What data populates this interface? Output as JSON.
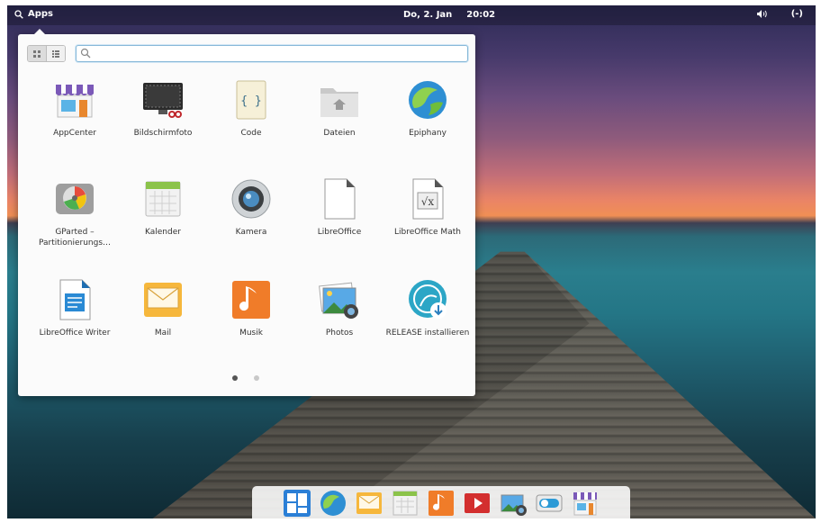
{
  "topbar": {
    "apps_label": "Apps",
    "date": "Do, 2. Jan",
    "time": "20:02",
    "session_symbol": "(-)"
  },
  "launcher": {
    "search_placeholder": "",
    "apps": [
      {
        "name": "AppCenter",
        "icon": "appcenter-icon"
      },
      {
        "name": "Bildschirmfoto",
        "icon": "screenshot-icon"
      },
      {
        "name": "Code",
        "icon": "code-icon"
      },
      {
        "name": "Dateien",
        "icon": "files-icon"
      },
      {
        "name": "Epiphany",
        "icon": "epiphany-icon"
      },
      {
        "name": "GParted – Partitionierungs…",
        "icon": "gparted-icon"
      },
      {
        "name": "Kalender",
        "icon": "calendar-icon"
      },
      {
        "name": "Kamera",
        "icon": "camera-icon"
      },
      {
        "name": "LibreOffice",
        "icon": "libreoffice-icon"
      },
      {
        "name": "LibreOffice Math",
        "icon": "libreoffice-math-icon"
      },
      {
        "name": "LibreOffice Writer",
        "icon": "libreoffice-writer-icon"
      },
      {
        "name": "Mail",
        "icon": "mail-icon"
      },
      {
        "name": "Musik",
        "icon": "music-icon"
      },
      {
        "name": "Photos",
        "icon": "photos-icon"
      },
      {
        "name": "RELEASE installieren",
        "icon": "installer-icon"
      }
    ],
    "pages_current": 1,
    "pages_total": 2
  },
  "dock": [
    {
      "icon": "multitasking-view-icon"
    },
    {
      "icon": "epiphany-icon"
    },
    {
      "icon": "mail-icon"
    },
    {
      "icon": "calendar-icon"
    },
    {
      "icon": "music-icon"
    },
    {
      "icon": "videos-icon"
    },
    {
      "icon": "photos-icon"
    },
    {
      "icon": "settings-icon"
    },
    {
      "icon": "appcenter-icon"
    }
  ]
}
